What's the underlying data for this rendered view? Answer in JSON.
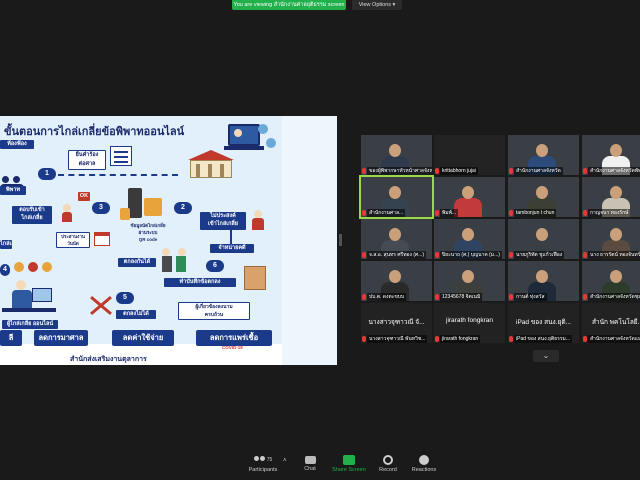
{
  "top_bar": {
    "viewing_text": "You are viewing สำนักงานศาลยุติธรรม screen",
    "view_options_label": "View Options ▾"
  },
  "slide": {
    "title": "ขั้นตอนการไกล่เกลี่ยข้อพิพาทออนไลน์",
    "corner_tag": "ท้องฟ้อง",
    "steps": [
      "1",
      "2",
      "3",
      "4",
      "5",
      "6"
    ],
    "boxes": {
      "file_request": "ยื่นคำร้อง\nต่อศาล",
      "no_mediation": "ไม่ประสงค์\nเข้าไกล่เกลี่ย",
      "agree_mediation": "ตอบรับเข้า\nไกล่เกลี่ย",
      "notify": "ประสานงาน\nวันนัด",
      "mediation_info": "ข้อมูลนัดไกล่เกลี่ย\nผ่านระบบ\nQR code",
      "dispose": "จำหน่ายคดี",
      "agreed": "ตกลงกันได้",
      "record": "ทำบันทึกข้อตกลง",
      "not_agreed": "ตกลงไม่ได้",
      "mediator": "ผู้ไกล่เกลี่ย\nออนไลน์",
      "parties_sign": "ผู้เกี่ยวข้องลงนาม\nครบถ้วน",
      "left_a": "พิพาท",
      "left_b": "ไกล่เกลี่ย"
    },
    "benefits": [
      "ลี",
      "ลดการมาศาล",
      "ลดค่าใช้จ่าย",
      "ลดการแพร่เชื้อ"
    ],
    "covid_tag": "COVID-19",
    "footer": "สำนักส่งเสริมงานตุลาการ"
  },
  "gallery": {
    "tiles": [
      {
        "name": "ของผู้พิพากษาหัวหน้าศาลจังหวัด",
        "kind": "video",
        "shirt": "#2f3a4d"
      },
      {
        "name": "krittabhorn jujai",
        "kind": "name"
      },
      {
        "name": "สำนักงานศาลจังหวัด",
        "kind": "video",
        "shirt": "#2c4a7a"
      },
      {
        "name": "สำนักงานศาลจังหวัดพัทลุง",
        "kind": "video",
        "shirt": "#f0f0f0"
      },
      {
        "name": "สำนักงานศาล...",
        "kind": "video",
        "shirt": "#35424f",
        "active": true
      },
      {
        "name": "พิมพ์...",
        "kind": "video",
        "shirt": "#c23a3a"
      },
      {
        "name": "tambonjun t chun",
        "kind": "video",
        "shirt": "#3b3f33"
      },
      {
        "name": "กาญจนา ทองรักษ์",
        "kind": "video",
        "shirt": "#c9c1b3"
      },
      {
        "name": "จ.ส.อ. สุนทร ศรีทอง (ศ...)",
        "kind": "video",
        "shirt": "#464a52"
      },
      {
        "name": "ปิยะนาถ (ศ.) บุญนาค (ม...)",
        "kind": "video",
        "shirt": "#2f4463"
      },
      {
        "name": "นายภูริทัต ชูแก้วเฟือง",
        "kind": "video",
        "shirt": "#3a3f46"
      },
      {
        "name": "นาง ธารรัตน์ ทองจันทร์",
        "kind": "video",
        "shirt": "#5a4a3f"
      },
      {
        "name": "ปบ.ต. ดงตะขบบ",
        "kind": "video",
        "shirt": "#2a2a2a"
      },
      {
        "name": "12345678 จิตเนมิ",
        "kind": "video",
        "shirt": "#3d3f3a"
      },
      {
        "name": "กานต์ ทุ่งสวัส",
        "kind": "video",
        "shirt": "#1e2a3a"
      },
      {
        "name": "สำนักงานศาลจังหวัดชุมพร",
        "kind": "video",
        "shirt": "#2d3b2a"
      },
      {
        "name": "นางสาวจุฑาวณี พันทวิช...",
        "big": "นางสาวจุฑาวณี จั...",
        "kind": "name"
      },
      {
        "name": "jirarath fongkran",
        "big": "jirarath fongkran",
        "kind": "name"
      },
      {
        "name": "iPad ของ สนง.ยุติธรรม...",
        "big": "iPad ของ สนง.ยุติ...",
        "kind": "name"
      },
      {
        "name": "สำนักงานศาลจังหวัดแม่ฮ่องสอน",
        "big": "สำนัก พคโนโลยี...",
        "kind": "name"
      }
    ]
  },
  "toolbar": {
    "participants_label": "Participants",
    "participants_count": "75",
    "chat_label": "Chat",
    "share_label": "Share Screen",
    "record_label": "Record",
    "reactions_label": "Reactions"
  },
  "colors": {
    "share_green": "#21b04b",
    "active_border": "#9ad84a",
    "slide_navy": "#1b3a8a"
  }
}
